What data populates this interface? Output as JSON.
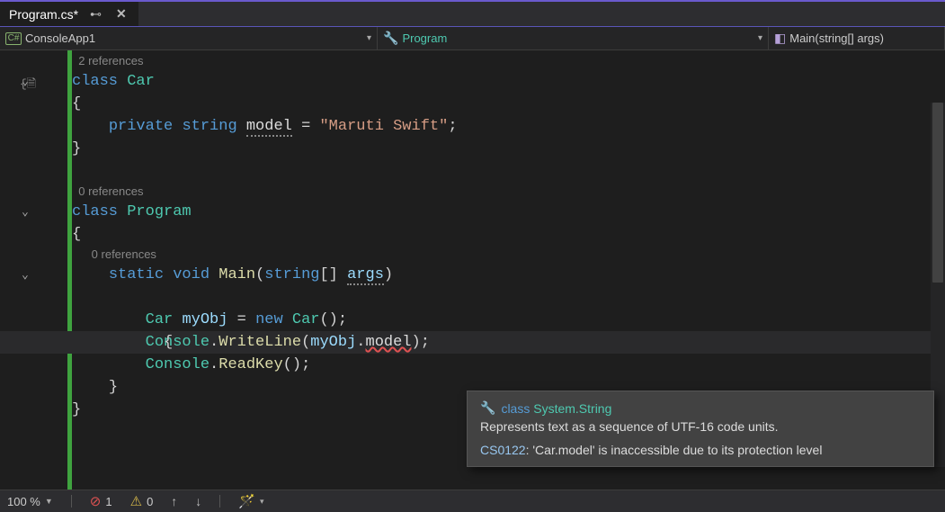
{
  "tab": {
    "title": "Program.cs*"
  },
  "nav": {
    "scope": "ConsoleApp1",
    "type": "Program",
    "member": "Main(string[] args)",
    "lang_badge": "C#"
  },
  "codelens": {
    "car_refs": "2 references",
    "program_refs": "0 references",
    "main_refs": "0 references"
  },
  "code": {
    "l1_class": "class",
    "l1_name": "Car",
    "l2": "{",
    "l3_private": "private",
    "l3_string": "string",
    "l3_model": "model",
    "l3_eq": " = ",
    "l3_value": "\"Maruti Swift\"",
    "l3_semi": ";",
    "l4": "}",
    "l6_class": "class",
    "l6_name": "Program",
    "l7": "{",
    "l8_static": "static",
    "l8_void": "void",
    "l8_main": "Main",
    "l8_openp": "(",
    "l8_string": "string",
    "l8_brack": "[]",
    "l8_args": "args",
    "l8_closep": ")",
    "l9": "{",
    "l10_car": "Car",
    "l10_obj": "myObj",
    "l10_eq": " = ",
    "l10_new": "new",
    "l10_car2": "Car",
    "l10_paren": "();",
    "l11_console": "Console",
    "l11_dot": ".",
    "l11_write": "WriteLine",
    "l11_open": "(",
    "l11_obj": "myObj",
    "l11_dot2": ".",
    "l11_model": "model",
    "l11_close": ");",
    "l12_console": "Console",
    "l12_dot": ".",
    "l12_read": "ReadKey",
    "l12_paren": "();",
    "l13": "}",
    "l14": "}"
  },
  "tooltip": {
    "kw_class": "class",
    "type_name": "System.String",
    "description": "Represents text as a sequence of UTF-16 code units.",
    "error_code": "CS0122",
    "error_msg": ": 'Car.model' is inaccessible due to its protection level"
  },
  "status": {
    "zoom": "100 %",
    "errors": "1",
    "warnings": "0"
  }
}
